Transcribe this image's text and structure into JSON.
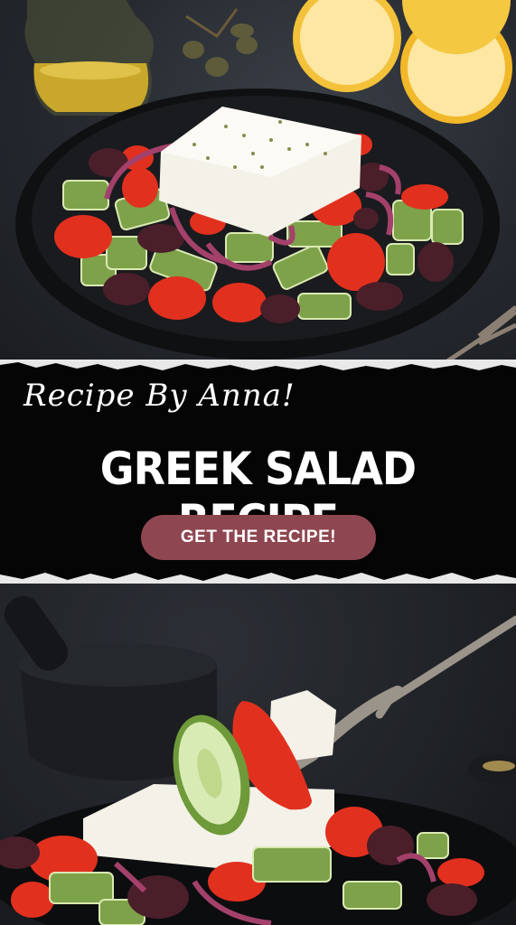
{
  "banner": {
    "script_title": "Recipe By Anna!",
    "main_title": "GREEK SALAD RECIPE",
    "cta_label": "GET THE RECIPE!",
    "accent_color": "#8e4651",
    "background_color": "#050505"
  },
  "images": {
    "top": "greek-salad-bowl-photo",
    "bottom": "salad-on-fork-photo"
  }
}
